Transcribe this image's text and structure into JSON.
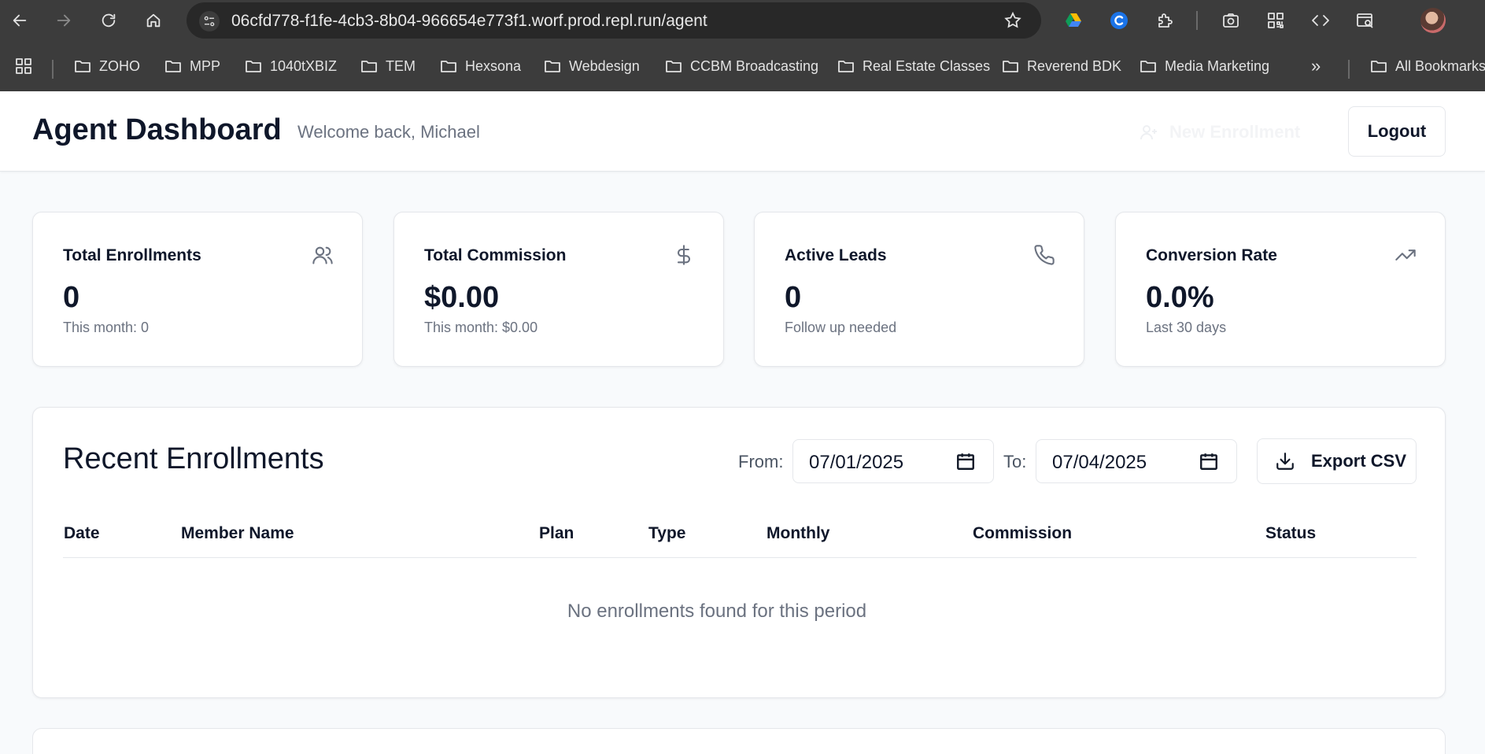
{
  "browser": {
    "url": "06cfd778-f1fe-4cb3-8b04-966654e773f1.worf.prod.repl.run/agent",
    "bookmarks": [
      "ZOHO",
      "MPP",
      "1040tXBIZ",
      "TEM",
      "Hexsona",
      "Webdesign",
      "CCBM Broadcasting",
      "Real Estate Classes",
      "Reverend BDK",
      "Media Marketing"
    ],
    "more_label": "»",
    "all_bookmarks": "All Bookmarks"
  },
  "header": {
    "title": "Agent Dashboard",
    "welcome": "Welcome back, Michael",
    "new_enrollment": "New Enrollment",
    "logout": "Logout"
  },
  "stats": [
    {
      "label": "Total Enrollments",
      "value": "0",
      "sub": "This month: 0",
      "icon": "users-icon"
    },
    {
      "label": "Total Commission",
      "value": "$0.00",
      "sub": "This month: $0.00",
      "icon": "dollar-icon"
    },
    {
      "label": "Active Leads",
      "value": "0",
      "sub": "Follow up needed",
      "icon": "phone-icon"
    },
    {
      "label": "Conversion Rate",
      "value": "0.0%",
      "sub": "Last 30 days",
      "icon": "trending-up-icon"
    }
  ],
  "enrollments": {
    "title": "Recent Enrollments",
    "from_label": "From:",
    "from_value": "07/01/2025",
    "to_label": "To:",
    "to_value": "07/04/2025",
    "export_label": "Export CSV",
    "columns": [
      "Date",
      "Member Name",
      "Plan",
      "Type",
      "Monthly",
      "Commission",
      "Status"
    ],
    "empty_message": "No enrollments found for this period"
  }
}
